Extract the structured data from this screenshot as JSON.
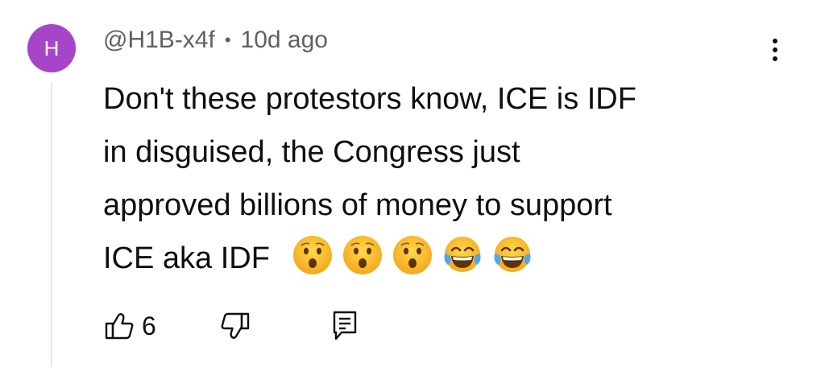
{
  "comment": {
    "avatar": {
      "initial": "H",
      "color": "#a745c9"
    },
    "author": "@H1B-x4f",
    "separator": "•",
    "timestamp": "10d ago",
    "text_lines": [
      "Don't these protestors know, ICE is IDF",
      "in disguised, the Congress just",
      "approved billions of money to support",
      "ICE aka IDF"
    ],
    "emojis": [
      "hushed-face-emoji",
      "hushed-face-emoji",
      "hushed-face-emoji",
      "tears-of-joy-emoji",
      "tears-of-joy-emoji"
    ],
    "like_count": "6"
  },
  "icons": {
    "like": "thumbs-up-icon",
    "dislike": "thumbs-down-icon",
    "reply": "reply-icon",
    "menu": "more-vertical-icon"
  }
}
